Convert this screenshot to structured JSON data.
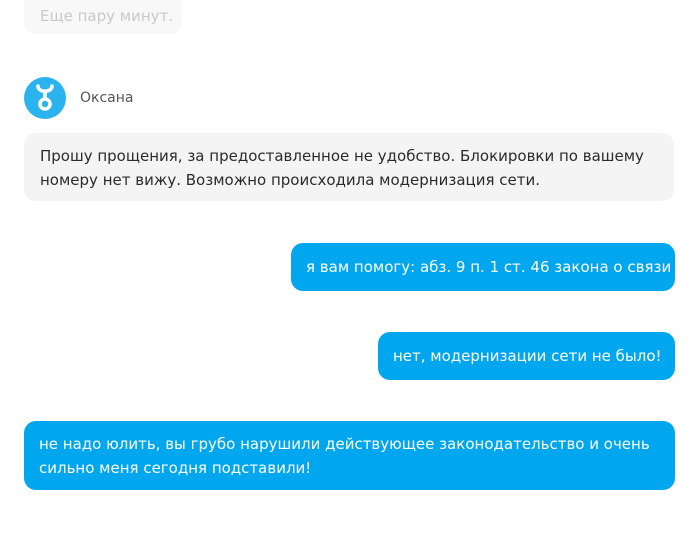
{
  "chat": {
    "previous_message": "Еще пару минут.",
    "operator": {
      "name": "Оксана",
      "avatar_icon": "yota-logo-icon",
      "avatar_color": "#2ab3ee"
    },
    "operator_message": {
      "line1": "Прошу прощения, за предоставленное не удобство. Блокировки по вашему",
      "line2": "номеру нет вижу. Возможно происходила модернизация сети."
    },
    "user_messages": [
      {
        "text": "я вам помогу: абз. 9 п. 1 ст. 46 закона о связи"
      },
      {
        "text": "нет, модернизации сети не было!"
      },
      {
        "line1": "не надо юлить, вы грубо нарушили действующее законодательство и очень",
        "line2": "сильно меня сегодня подставили!"
      }
    ],
    "colors": {
      "user_bubble": "#00a6ee",
      "operator_bubble": "#f4f4f4"
    }
  }
}
